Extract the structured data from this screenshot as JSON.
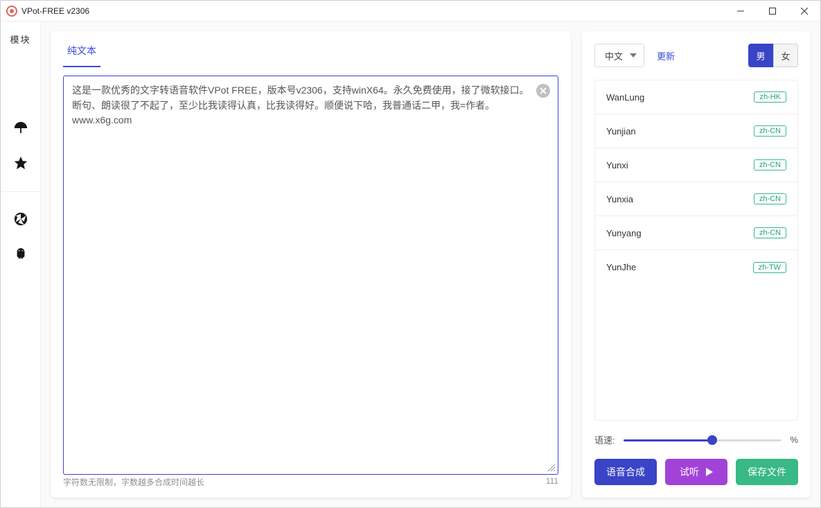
{
  "window": {
    "title": "VPot-FREE v2306"
  },
  "rail": {
    "label": "模块"
  },
  "tabs": {
    "plain": "纯文本"
  },
  "editor": {
    "text": "这是一款优秀的文字转语音软件VPot FREE，版本号v2306，支持winX64。永久免费使用，接了微软接口。断句、朗读很了不起了，至少比我读得认真，比我读得好。顺便说下哈，我普通话二甲，我=作者。\nwww.x6g.com",
    "hint": "字符数无限制，字数越多合成时间越长",
    "char_count": "111"
  },
  "lang_select": "中文",
  "update_link": "更新",
  "gender": {
    "male": "男",
    "female": "女"
  },
  "voices": [
    {
      "name": "WanLung",
      "locale": "zh-HK"
    },
    {
      "name": "Yunjian",
      "locale": "zh-CN"
    },
    {
      "name": "Yunxi",
      "locale": "zh-CN"
    },
    {
      "name": "Yunxia",
      "locale": "zh-CN"
    },
    {
      "name": "Yunyang",
      "locale": "zh-CN"
    },
    {
      "name": "YunJhe",
      "locale": "zh-TW"
    }
  ],
  "speed": {
    "label": "语速:",
    "percent": "%"
  },
  "buttons": {
    "synth": "语音合成",
    "listen": "试听",
    "save": "保存文件"
  }
}
